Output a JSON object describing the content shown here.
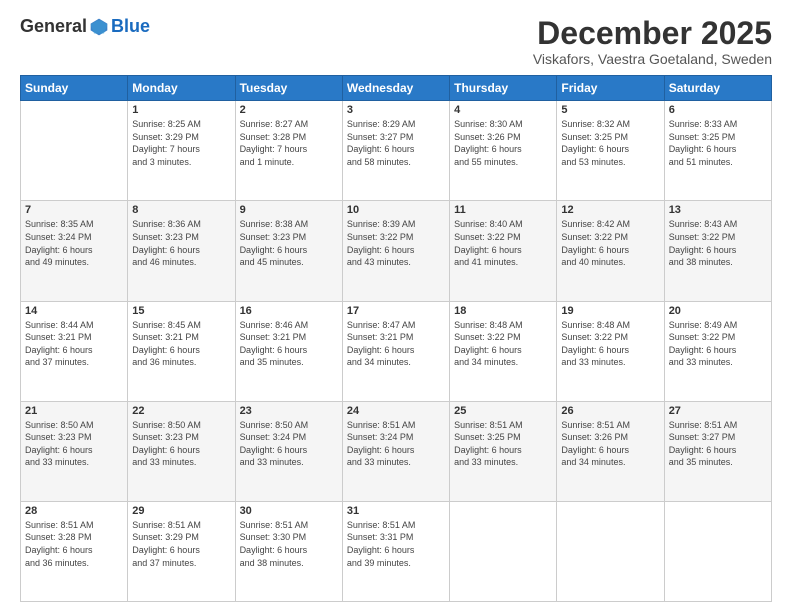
{
  "header": {
    "logo_general": "General",
    "logo_blue": "Blue",
    "month_title": "December 2025",
    "location": "Viskafors, Vaestra Goetaland, Sweden"
  },
  "days_of_week": [
    "Sunday",
    "Monday",
    "Tuesday",
    "Wednesday",
    "Thursday",
    "Friday",
    "Saturday"
  ],
  "weeks": [
    [
      {
        "day": "",
        "info": ""
      },
      {
        "day": "1",
        "info": "Sunrise: 8:25 AM\nSunset: 3:29 PM\nDaylight: 7 hours\nand 3 minutes."
      },
      {
        "day": "2",
        "info": "Sunrise: 8:27 AM\nSunset: 3:28 PM\nDaylight: 7 hours\nand 1 minute."
      },
      {
        "day": "3",
        "info": "Sunrise: 8:29 AM\nSunset: 3:27 PM\nDaylight: 6 hours\nand 58 minutes."
      },
      {
        "day": "4",
        "info": "Sunrise: 8:30 AM\nSunset: 3:26 PM\nDaylight: 6 hours\nand 55 minutes."
      },
      {
        "day": "5",
        "info": "Sunrise: 8:32 AM\nSunset: 3:25 PM\nDaylight: 6 hours\nand 53 minutes."
      },
      {
        "day": "6",
        "info": "Sunrise: 8:33 AM\nSunset: 3:25 PM\nDaylight: 6 hours\nand 51 minutes."
      }
    ],
    [
      {
        "day": "7",
        "info": "Sunrise: 8:35 AM\nSunset: 3:24 PM\nDaylight: 6 hours\nand 49 minutes."
      },
      {
        "day": "8",
        "info": "Sunrise: 8:36 AM\nSunset: 3:23 PM\nDaylight: 6 hours\nand 46 minutes."
      },
      {
        "day": "9",
        "info": "Sunrise: 8:38 AM\nSunset: 3:23 PM\nDaylight: 6 hours\nand 45 minutes."
      },
      {
        "day": "10",
        "info": "Sunrise: 8:39 AM\nSunset: 3:22 PM\nDaylight: 6 hours\nand 43 minutes."
      },
      {
        "day": "11",
        "info": "Sunrise: 8:40 AM\nSunset: 3:22 PM\nDaylight: 6 hours\nand 41 minutes."
      },
      {
        "day": "12",
        "info": "Sunrise: 8:42 AM\nSunset: 3:22 PM\nDaylight: 6 hours\nand 40 minutes."
      },
      {
        "day": "13",
        "info": "Sunrise: 8:43 AM\nSunset: 3:22 PM\nDaylight: 6 hours\nand 38 minutes."
      }
    ],
    [
      {
        "day": "14",
        "info": "Sunrise: 8:44 AM\nSunset: 3:21 PM\nDaylight: 6 hours\nand 37 minutes."
      },
      {
        "day": "15",
        "info": "Sunrise: 8:45 AM\nSunset: 3:21 PM\nDaylight: 6 hours\nand 36 minutes."
      },
      {
        "day": "16",
        "info": "Sunrise: 8:46 AM\nSunset: 3:21 PM\nDaylight: 6 hours\nand 35 minutes."
      },
      {
        "day": "17",
        "info": "Sunrise: 8:47 AM\nSunset: 3:21 PM\nDaylight: 6 hours\nand 34 minutes."
      },
      {
        "day": "18",
        "info": "Sunrise: 8:48 AM\nSunset: 3:22 PM\nDaylight: 6 hours\nand 34 minutes."
      },
      {
        "day": "19",
        "info": "Sunrise: 8:48 AM\nSunset: 3:22 PM\nDaylight: 6 hours\nand 33 minutes."
      },
      {
        "day": "20",
        "info": "Sunrise: 8:49 AM\nSunset: 3:22 PM\nDaylight: 6 hours\nand 33 minutes."
      }
    ],
    [
      {
        "day": "21",
        "info": "Sunrise: 8:50 AM\nSunset: 3:23 PM\nDaylight: 6 hours\nand 33 minutes."
      },
      {
        "day": "22",
        "info": "Sunrise: 8:50 AM\nSunset: 3:23 PM\nDaylight: 6 hours\nand 33 minutes."
      },
      {
        "day": "23",
        "info": "Sunrise: 8:50 AM\nSunset: 3:24 PM\nDaylight: 6 hours\nand 33 minutes."
      },
      {
        "day": "24",
        "info": "Sunrise: 8:51 AM\nSunset: 3:24 PM\nDaylight: 6 hours\nand 33 minutes."
      },
      {
        "day": "25",
        "info": "Sunrise: 8:51 AM\nSunset: 3:25 PM\nDaylight: 6 hours\nand 33 minutes."
      },
      {
        "day": "26",
        "info": "Sunrise: 8:51 AM\nSunset: 3:26 PM\nDaylight: 6 hours\nand 34 minutes."
      },
      {
        "day": "27",
        "info": "Sunrise: 8:51 AM\nSunset: 3:27 PM\nDaylight: 6 hours\nand 35 minutes."
      }
    ],
    [
      {
        "day": "28",
        "info": "Sunrise: 8:51 AM\nSunset: 3:28 PM\nDaylight: 6 hours\nand 36 minutes."
      },
      {
        "day": "29",
        "info": "Sunrise: 8:51 AM\nSunset: 3:29 PM\nDaylight: 6 hours\nand 37 minutes."
      },
      {
        "day": "30",
        "info": "Sunrise: 8:51 AM\nSunset: 3:30 PM\nDaylight: 6 hours\nand 38 minutes."
      },
      {
        "day": "31",
        "info": "Sunrise: 8:51 AM\nSunset: 3:31 PM\nDaylight: 6 hours\nand 39 minutes."
      },
      {
        "day": "",
        "info": ""
      },
      {
        "day": "",
        "info": ""
      },
      {
        "day": "",
        "info": ""
      }
    ]
  ]
}
